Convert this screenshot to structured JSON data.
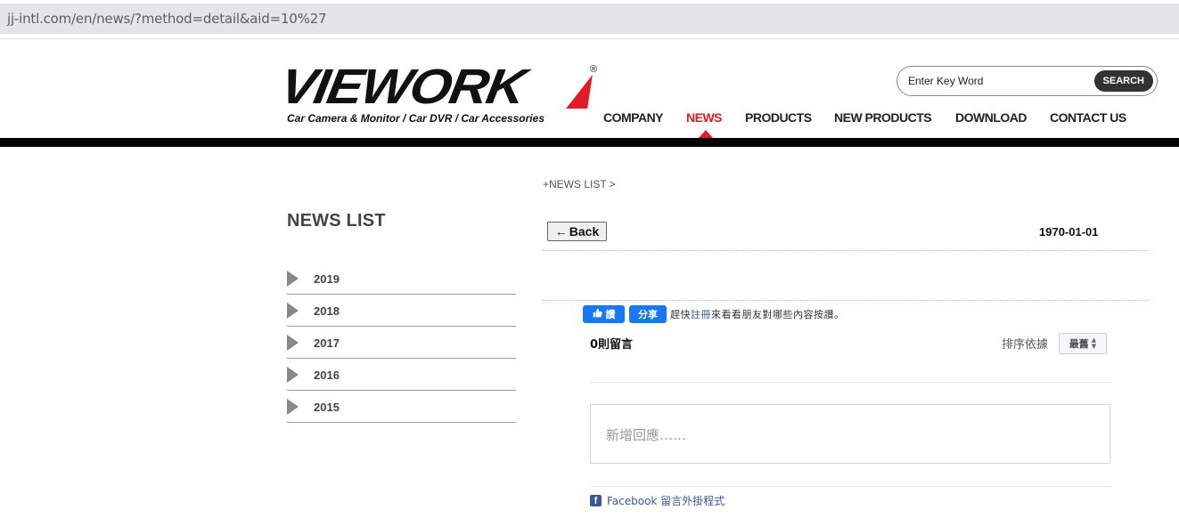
{
  "browser": {
    "url": "jj-intl.com/en/news/?method=detail&aid=10%27"
  },
  "header": {
    "logo_text": "VIEWORK",
    "logo_registered": "®",
    "tagline": "Car Camera & Monitor  /  Car DVR  /  Car Accessories",
    "search": {
      "placeholder": "Enter Key Word",
      "button_label": "SEARCH"
    },
    "nav": [
      {
        "label": "COMPANY",
        "active": false
      },
      {
        "label": "NEWS",
        "active": true
      },
      {
        "label": "PRODUCTS",
        "active": false
      },
      {
        "label": "NEW PRODUCTS",
        "active": false
      },
      {
        "label": "DOWNLOAD",
        "active": false
      },
      {
        "label": "CONTACT US",
        "active": false
      }
    ],
    "accent_color": "#e31b23"
  },
  "sidebar": {
    "title": "NEWS LIST",
    "years": [
      "2019",
      "2018",
      "2017",
      "2016",
      "2015"
    ]
  },
  "main": {
    "breadcrumb": "+NEWS LIST >",
    "back_label": "Back",
    "date": "1970-01-01"
  },
  "facebook": {
    "like_label": "讚",
    "share_label": "分享",
    "prompt_prefix": "趕快",
    "prompt_link": "註冊",
    "prompt_suffix": "來看看朋友對哪些內容按讚。",
    "comment_count": "0則留言",
    "sort_label": "排序依據",
    "sort_value": "最舊",
    "comment_placeholder": "新增回應……",
    "plugin_label": "Facebook 留言外掛程式",
    "brand_color": "#1877f2"
  }
}
